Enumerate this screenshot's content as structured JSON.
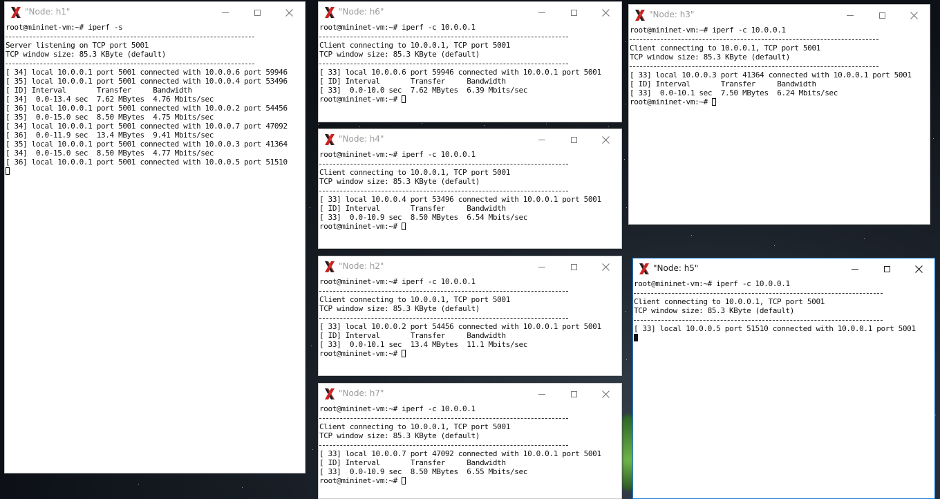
{
  "desktop": {
    "background_color": "#10151b"
  },
  "windows": {
    "h1": {
      "title": "\"Node: h1\"",
      "lines": [
        "root@mininet-vm:~# iperf -s",
        "---",
        "Server listening on TCP port 5001",
        "TCP window size: 85.3 KByte (default)",
        "---",
        "[ 34] local 10.0.0.1 port 5001 connected with 10.0.0.6 port 59946",
        "[ 35] local 10.0.0.1 port 5001 connected with 10.0.0.4 port 53496",
        "[ ID] Interval       Transfer     Bandwidth",
        "[ 34]  0.0-13.4 sec  7.62 MBytes  4.76 Mbits/sec",
        "[ 36] local 10.0.0.1 port 5001 connected with 10.0.0.2 port 54456",
        "[ 35]  0.0-15.0 sec  8.50 MBytes  4.75 Mbits/sec",
        "[ 34] local 10.0.0.1 port 5001 connected with 10.0.0.7 port 47092",
        "[ 36]  0.0-11.9 sec  13.4 MBytes  9.41 Mbits/sec",
        "[ 35] local 10.0.0.1 port 5001 connected with 10.0.0.3 port 41364",
        "[ 34]  0.0-15.0 sec  8.50 MBytes  4.77 Mbits/sec",
        "[ 36] local 10.0.0.1 port 5001 connected with 10.0.0.5 port 51510"
      ]
    },
    "h6": {
      "title": "\"Node: h6\"",
      "lines": [
        "root@mininet-vm:~# iperf -c 10.0.0.1",
        "---",
        "Client connecting to 10.0.0.1, TCP port 5001",
        "TCP window size: 85.3 KByte (default)",
        "---",
        "[ 33] local 10.0.0.6 port 59946 connected with 10.0.0.1 port 5001",
        "[ ID] Interval       Transfer     Bandwidth",
        "[ 33]  0.0-10.0 sec  7.62 MBytes  6.39 Mbits/sec",
        "root@mininet-vm:~# "
      ]
    },
    "h3": {
      "title": "\"Node: h3\"",
      "lines": [
        "root@mininet-vm:~# iperf -c 10.0.0.1",
        "---",
        "Client connecting to 10.0.0.1, TCP port 5001",
        "TCP window size: 85.3 KByte (default)",
        "---",
        "[ 33] local 10.0.0.3 port 41364 connected with 10.0.0.1 port 5001",
        "[ ID] Interval       Transfer     Bandwidth",
        "[ 33]  0.0-10.1 sec  7.50 MBytes  6.24 Mbits/sec",
        "root@mininet-vm:~# "
      ]
    },
    "h4": {
      "title": "\"Node: h4\"",
      "lines": [
        "root@mininet-vm:~# iperf -c 10.0.0.1",
        "---",
        "Client connecting to 10.0.0.1, TCP port 5001",
        "TCP window size: 85.3 KByte (default)",
        "---",
        "[ 33] local 10.0.0.4 port 53496 connected with 10.0.0.1 port 5001",
        "[ ID] Interval       Transfer     Bandwidth",
        "[ 33]  0.0-10.9 sec  8.50 MBytes  6.54 Mbits/sec",
        "root@mininet-vm:~# "
      ]
    },
    "h2": {
      "title": "\"Node: h2\"",
      "lines": [
        "root@mininet-vm:~# iperf -c 10.0.0.1",
        "---",
        "Client connecting to 10.0.0.1, TCP port 5001",
        "TCP window size: 85.3 KByte (default)",
        "---",
        "[ 33] local 10.0.0.2 port 54456 connected with 10.0.0.1 port 5001",
        "[ ID] Interval       Transfer     Bandwidth",
        "[ 33]  0.0-10.1 sec  13.4 MBytes  11.1 Mbits/sec",
        "root@mininet-vm:~# "
      ]
    },
    "h5": {
      "title": "\"Node: h5\"",
      "lines": [
        "root@mininet-vm:~# iperf -c 10.0.0.1",
        "---",
        "Client connecting to 10.0.0.1, TCP port 5001",
        "TCP window size: 85.3 KByte (default)",
        "---",
        "[ 33] local 10.0.0.5 port 51510 connected with 10.0.0.1 port 5001"
      ]
    },
    "h7": {
      "title": "\"Node: h7\"",
      "lines": [
        "root@mininet-vm:~# iperf -c 10.0.0.1",
        "---",
        "Client connecting to 10.0.0.1, TCP port 5001",
        "TCP window size: 85.3 KByte (default)",
        "---",
        "[ 33] local 10.0.0.7 port 47092 connected with 10.0.0.1 port 5001",
        "[ ID] Interval       Transfer     Bandwidth",
        "[ 33]  0.0-10.9 sec  8.50 MBytes  6.55 Mbits/sec",
        "root@mininet-vm:~# "
      ]
    }
  },
  "icons": {
    "app_icon": "x11-icon",
    "minimize": "minimize-icon",
    "maximize": "maximize-icon",
    "close": "close-icon"
  }
}
